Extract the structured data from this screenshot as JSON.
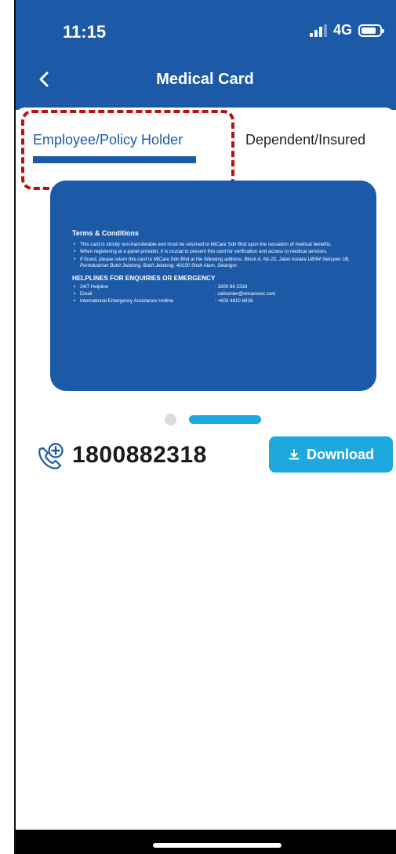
{
  "status_bar": {
    "time": "11:15",
    "network": "4G"
  },
  "header": {
    "title": "Medical Card"
  },
  "tabs": [
    {
      "label": "Employee/Policy Holder",
      "active": true
    },
    {
      "label": "Dependent/Insured",
      "active": false
    }
  ],
  "card": {
    "terms_title": "Terms & Conditions",
    "terms": [
      "This card is strictly non-transferable and must be returned to MiCare Sdn Bhd upon the cessation of medical benefits.",
      "When registering at a panel provider, it is crucial to present this card for verification and access to medical services."
    ],
    "found_text": "If found, please return this card to MiCare Sdn Bhd at the following address: ",
    "found_address": "Block A, No.22, Jalan Astaka U8/84 Seksyen U8, Perindustrian Bukit Jelutong, Bukit Jelutong, 40150 Shah Alam, Selangor.",
    "helplines_title": "HELPLINES FOR ENQUIRIES OR EMERGENCY",
    "helplines": [
      {
        "label": "24/7 Helpline",
        "value": ": 1800 88 2318"
      },
      {
        "label": "Email",
        "value": ": callcenter@micaresvc.com"
      },
      {
        "label": "International Emergency Assistance Hotline",
        "value": ": +603 4810 6816"
      }
    ]
  },
  "pager": {
    "pages": 2,
    "active_page": 2
  },
  "contact": {
    "phone": "1800882318"
  },
  "download": {
    "label": "Download"
  },
  "colors": {
    "brand_blue": "#1c5aa8",
    "accent_cyan": "#1ea8e0",
    "highlight_red": "#b80f0f"
  }
}
